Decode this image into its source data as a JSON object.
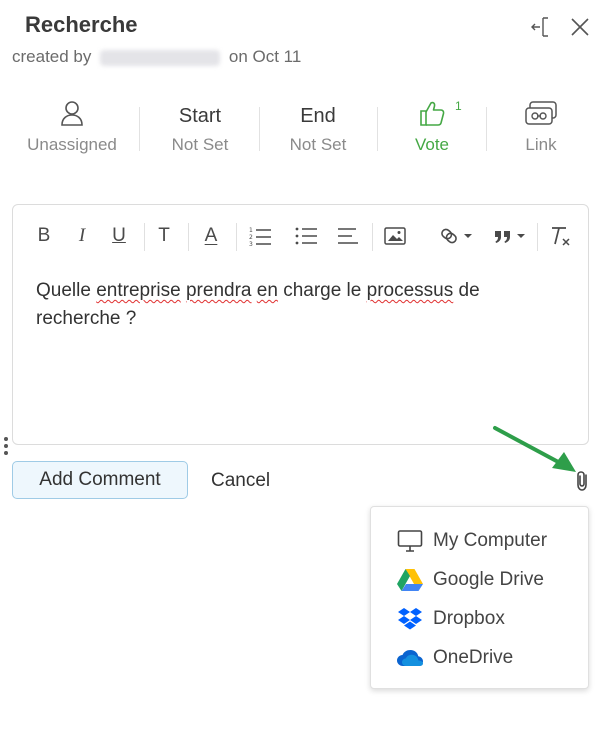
{
  "header": {
    "title": "Recherche",
    "created_prefix": "created by",
    "created_suffix": "on Oct 11"
  },
  "meta": {
    "assignee": "Unassigned",
    "start_label": "Start",
    "start_value": "Not Set",
    "end_label": "End",
    "end_value": "Not Set",
    "vote_label": "Vote",
    "vote_count": "1",
    "link_label": "Link"
  },
  "editor": {
    "toolbar": {
      "bold": "B",
      "italic": "I",
      "underline": "U",
      "text": "T",
      "font_color": "A"
    },
    "content": {
      "w1": "Quelle",
      "w2": "entreprise",
      "w3": "prendra",
      "w4": "en",
      "w5": "charge le",
      "w6": "processus",
      "w7": "de recherche ?"
    }
  },
  "actions": {
    "add_comment": "Add Comment",
    "cancel": "Cancel"
  },
  "attach_menu": {
    "items": [
      {
        "label": "My Computer",
        "icon": "monitor-icon"
      },
      {
        "label": "Google Drive",
        "icon": "google-drive-icon"
      },
      {
        "label": "Dropbox",
        "icon": "dropbox-icon"
      },
      {
        "label": "OneDrive",
        "icon": "onedrive-icon"
      }
    ]
  },
  "colors": {
    "vote_green": "#45a845",
    "arrow_green": "#2e9e4a",
    "button_bg": "#eef7fd",
    "button_border": "#9fcbe6"
  }
}
